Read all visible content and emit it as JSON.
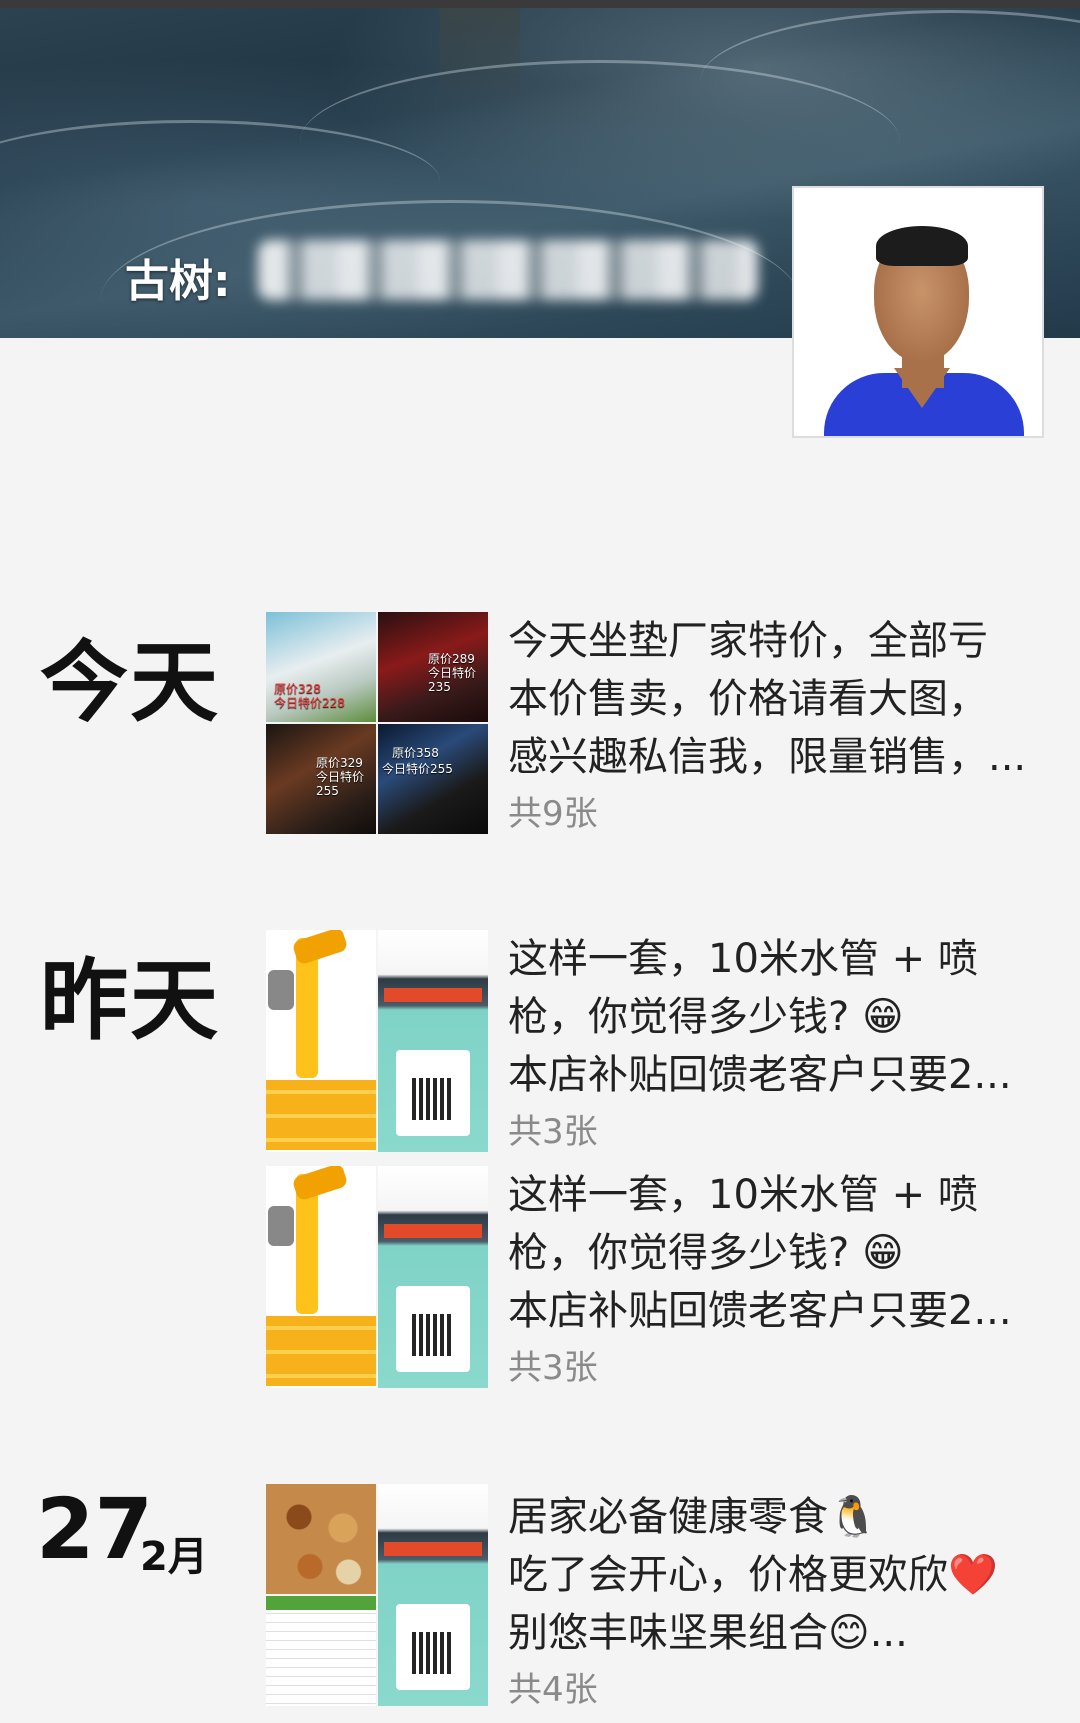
{
  "profile": {
    "nickname": "古树:"
  },
  "feed": [
    {
      "day_label": "今天",
      "posts": [
        {
          "lines": [
            "今天坐垫厂家特价，全部亏",
            "本价售卖，价格请看大图，",
            "感兴趣私信我，限量销售，..."
          ],
          "count": "共9张",
          "thumb_texts": [
            "原价328",
            "今日特价228",
            "原价289",
            "今日特价235",
            "原价329",
            "今日特价255",
            "原价358",
            "今日特价255"
          ]
        }
      ]
    },
    {
      "day_label": "昨天",
      "posts": [
        {
          "lines": [
            "这样一套，10米水管 + 喷",
            "枪，你觉得多少钱? 😁",
            "本店补贴回馈老客户只要2..."
          ],
          "count": "共3张"
        },
        {
          "lines": [
            "这样一套，10米水管 + 喷",
            "枪，你觉得多少钱? 😁",
            "本店补贴回馈老客户只要2..."
          ],
          "count": "共3张"
        }
      ]
    },
    {
      "date_day": "27",
      "date_month": "2月",
      "posts": [
        {
          "lines": [
            "居家必备健康零食🐧",
            "吃了会开心，价格更欢欣❤️",
            "别悠丰味坚果组合😊..."
          ],
          "count": "共4张"
        }
      ]
    }
  ],
  "colors": {
    "background": "#f4f4f4",
    "text": "#222222",
    "count_text": "#8a8a8a"
  }
}
